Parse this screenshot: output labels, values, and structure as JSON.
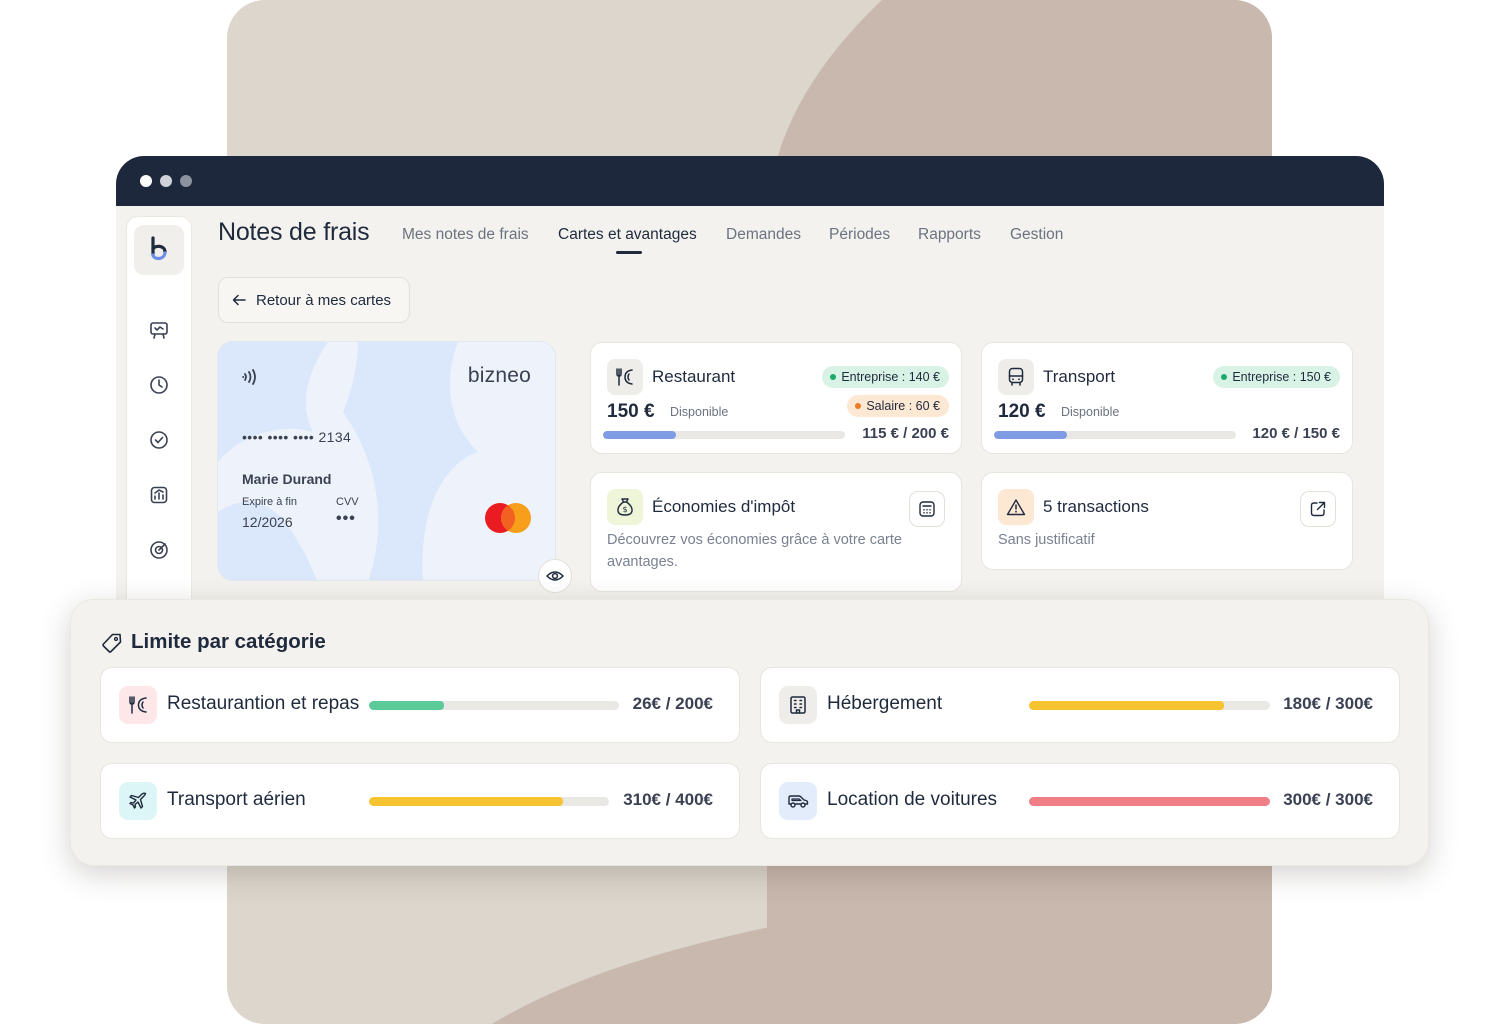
{
  "app": {
    "title": "Notes de frais",
    "tabs": [
      {
        "label": "Mes notes de frais",
        "active": false
      },
      {
        "label": "Cartes et avantages",
        "active": true
      },
      {
        "label": "Demandes",
        "active": false
      },
      {
        "label": "Périodes",
        "active": false
      },
      {
        "label": "Rapports",
        "active": false
      },
      {
        "label": "Gestion",
        "active": false
      }
    ],
    "back_button": "Retour à mes cartes",
    "sidebar_icons": [
      "logo-b-icon",
      "presentation-icon",
      "clock-icon",
      "check-circle-icon",
      "chart-icon",
      "target-icon"
    ]
  },
  "card": {
    "brand": "bizneo",
    "number": "•••• •••• •••• 2134",
    "holder": "Marie Durand",
    "expiry_label": "Expire à fin",
    "expiry": "12/2026",
    "cvv_label": "CVV",
    "cvv": "•••",
    "network": "mastercard-icon"
  },
  "benefits": [
    {
      "name": "Restaurant",
      "icon": "fork-knife-icon",
      "amount": "150 €",
      "available_label": "Disponible",
      "company_pill": "Entreprise : 140 €",
      "salary_pill": "Salaire : 60 €",
      "used": "115 € / 200 €",
      "progress": 0.3
    },
    {
      "name": "Transport",
      "icon": "bus-icon",
      "amount": "120 €",
      "available_label": "Disponible",
      "company_pill": "Entreprise : 150 €",
      "used": "120 € / 150 €",
      "progress": 0.3
    }
  ],
  "tax": {
    "title": "Économies d'impôt",
    "description": "Découvrez vos économies grâce à votre carte avantages.",
    "icon": "money-bag-icon",
    "action_icon": "calculator-icon"
  },
  "transactions": {
    "title": "5 transactions",
    "subtitle": "Sans justificatif",
    "icon": "warning-icon",
    "action_icon": "external-link-icon"
  },
  "limits": {
    "title": "Limite par catégorie",
    "icon": "tag-icon",
    "categories": [
      {
        "label": "Restaurantion et repas",
        "value": "26€ / 200€",
        "progress": 0.3,
        "color": "#5cc999",
        "icon": "fork-knife-icon",
        "icon_bg": "#fde7e9"
      },
      {
        "label": "Hébergement",
        "value": "180€ / 300€",
        "progress": 0.81,
        "color": "#f7c431",
        "icon": "building-icon",
        "icon_bg": "#efedea"
      },
      {
        "label": "Transport aérien",
        "value": "310€ / 400€",
        "progress": 0.81,
        "color": "#f7c431",
        "icon": "plane-icon",
        "icon_bg": "#dcf5f6"
      },
      {
        "label": "Location de voitures",
        "value": "300€ / 300€",
        "progress": 1.0,
        "color": "#ef7e86",
        "icon": "car-icon",
        "icon_bg": "#e3ecfa"
      }
    ]
  },
  "colors": {
    "titlebar": "#1e283c",
    "progress_blue": "#7f9be3",
    "background_beige": "#dcd6cc",
    "background_taupe": "#c9b8ad"
  }
}
